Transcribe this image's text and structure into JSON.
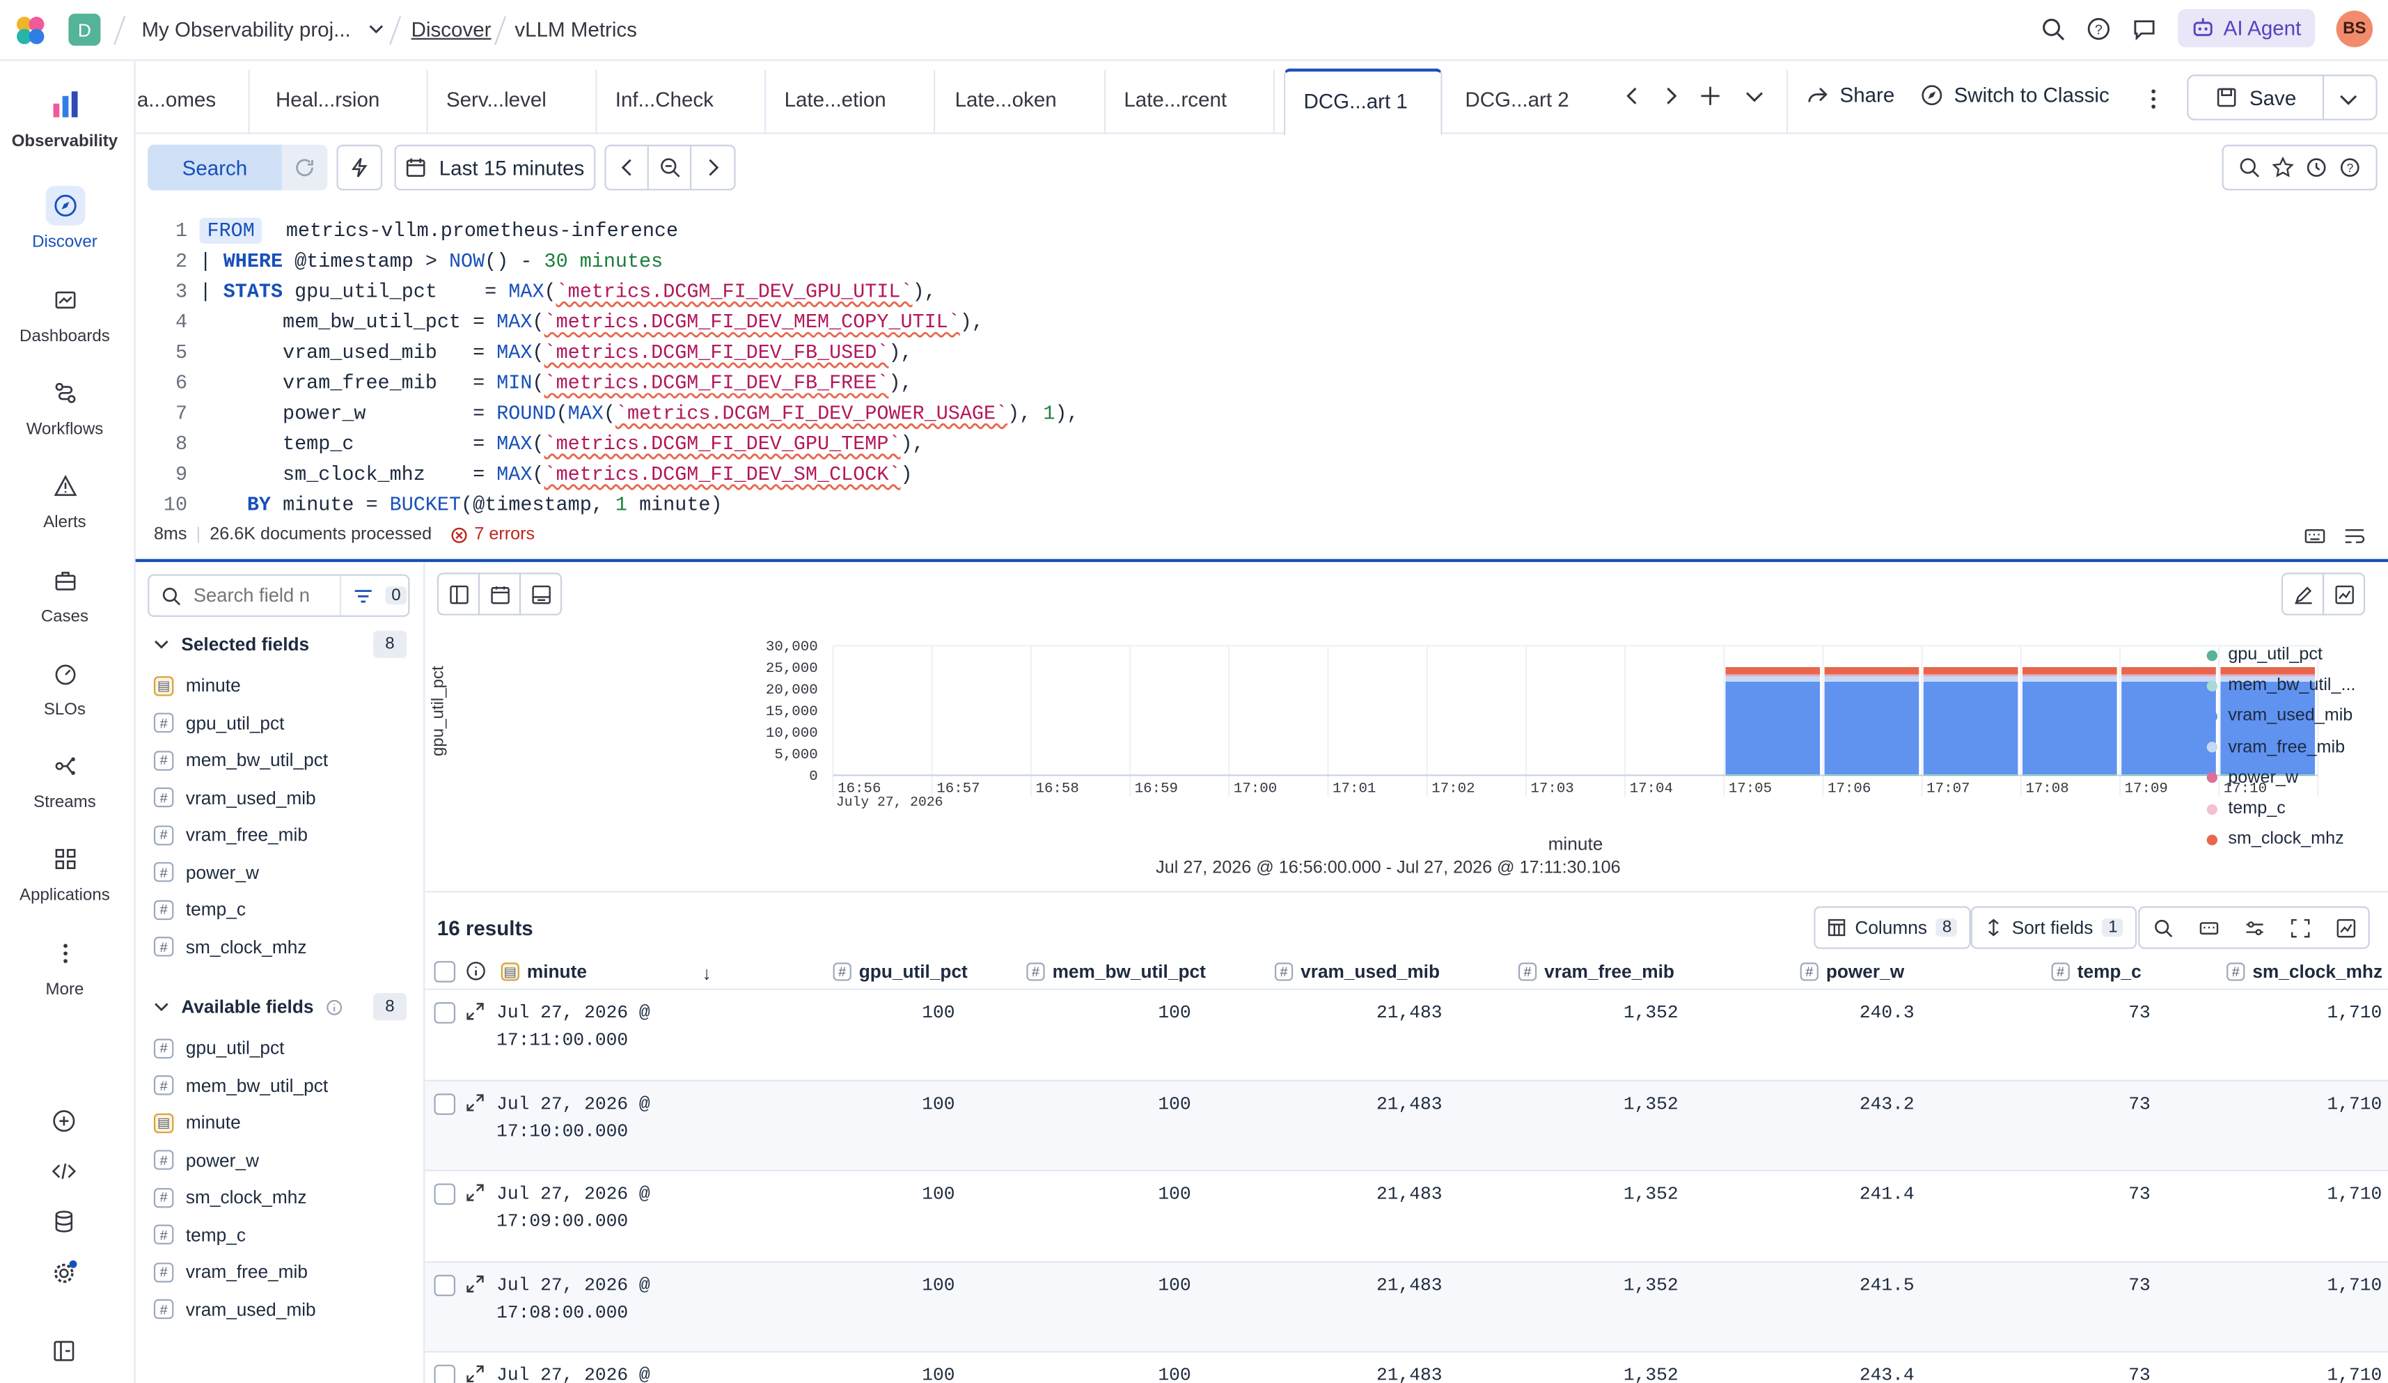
{
  "app": {
    "space_initial": "D",
    "project": "My Observability proj...",
    "breadcrumb_discover": "Discover",
    "breadcrumb_current": "vLLM Metrics",
    "ai_agent_label": "AI Agent",
    "avatar_initials": "BS",
    "brand_color": "#1750ba"
  },
  "nav": {
    "observability": "Observability",
    "discover": "Discover",
    "dashboards": "Dashboards",
    "workflows": "Workflows",
    "alerts": "Alerts",
    "cases": "Cases",
    "slos": "SLOs",
    "streams": "Streams",
    "applications": "Applications",
    "more": "More"
  },
  "tabs": [
    {
      "label": "a...omes"
    },
    {
      "label": "Heal...rsion"
    },
    {
      "label": "Serv...level"
    },
    {
      "label": "Inf...Check"
    },
    {
      "label": "Late...etion"
    },
    {
      "label": "Late...oken"
    },
    {
      "label": "Late...rcent"
    },
    {
      "label": "DCG...art 1"
    },
    {
      "label": "DCG...art 2"
    }
  ],
  "toolbar": {
    "share": "Share",
    "switch_classic": "Switch to Classic",
    "save": "Save",
    "search": "Search",
    "time_range": "Last 15 minutes"
  },
  "query": {
    "lines": [
      "1",
      "2",
      "3",
      "4",
      "5",
      "6",
      "7",
      "8",
      "9",
      "10"
    ],
    "status_ms": "8ms",
    "status_docs": "26.6K documents processed",
    "status_errors": "7 errors"
  },
  "fields": {
    "search_placeholder": "Search field n",
    "filter_count": "0",
    "selected_label": "Selected fields",
    "selected_count": "8",
    "selected": [
      "minute",
      "gpu_util_pct",
      "mem_bw_util_pct",
      "vram_used_mib",
      "vram_free_mib",
      "power_w",
      "temp_c",
      "sm_clock_mhz"
    ],
    "available_label": "Available fields",
    "available_count": "8",
    "available": [
      "gpu_util_pct",
      "mem_bw_util_pct",
      "minute",
      "power_w",
      "sm_clock_mhz",
      "temp_c",
      "vram_free_mib",
      "vram_used_mib"
    ]
  },
  "chart_data": {
    "type": "bar",
    "xlabel": "minute",
    "ylabel": "gpu_util_pct",
    "ylim": [
      0,
      30000
    ],
    "yticks": [
      "30,000",
      "25,000",
      "20,000",
      "15,000",
      "10,000",
      "5,000",
      "0"
    ],
    "categories": [
      "16:56",
      "16:57",
      "16:58",
      "16:59",
      "17:00",
      "17:01",
      "17:02",
      "17:03",
      "17:04",
      "17:05",
      "17:06",
      "17:07",
      "17:08",
      "17:09",
      "17:10"
    ],
    "first_tick_date": "July 27, 2026",
    "series": [
      {
        "name": "gpu_util_pct",
        "color": "#54b399",
        "values": [
          0,
          0,
          0,
          0,
          0,
          0,
          0,
          0,
          0,
          100,
          100,
          100,
          100,
          100,
          100
        ]
      },
      {
        "name": "mem_bw_util_...",
        "color": "#a8dbd3",
        "values": [
          0,
          0,
          0,
          0,
          0,
          0,
          0,
          0,
          0,
          100,
          100,
          100,
          100,
          100,
          100
        ]
      },
      {
        "name": "vram_used_mib",
        "color": "#6092f0",
        "values": [
          0,
          0,
          0,
          0,
          0,
          0,
          0,
          0,
          0,
          21483,
          21483,
          21483,
          21483,
          21483,
          21483
        ]
      },
      {
        "name": "vram_free_mib",
        "color": "#c7d8f5",
        "values": [
          0,
          0,
          0,
          0,
          0,
          0,
          0,
          0,
          0,
          1352,
          1352,
          1352,
          1352,
          1352,
          1352
        ]
      },
      {
        "name": "power_w",
        "color": "#e06f98",
        "values": [
          0,
          0,
          0,
          0,
          0,
          0,
          0,
          0,
          0,
          243,
          243,
          241,
          242,
          243,
          240
        ]
      },
      {
        "name": "temp_c",
        "color": "#f4c0d2",
        "values": [
          0,
          0,
          0,
          0,
          0,
          0,
          0,
          0,
          0,
          73,
          73,
          73,
          73,
          73,
          73
        ]
      },
      {
        "name": "sm_clock_mhz",
        "color": "#e7664c",
        "values": [
          0,
          0,
          0,
          0,
          0,
          0,
          0,
          0,
          0,
          1710,
          1710,
          1710,
          1710,
          1710,
          1710
        ]
      }
    ]
  },
  "chart_range": "Jul 27, 2026 @ 16:56:00.000 - Jul 27, 2026 @ 17:11:30.106",
  "results": {
    "count_label": "16 results",
    "columns_label": "Columns",
    "columns_count": "8",
    "sort_label": "Sort fields",
    "sort_count": "1",
    "headers": [
      "minute",
      "gpu_util_pct",
      "mem_bw_util_pct",
      "vram_used_mib",
      "vram_free_mib",
      "power_w",
      "temp_c",
      "sm_clock_mhz"
    ],
    "rows": [
      {
        "minute1": "Jul 27, 2026 @",
        "minute2": "17:11:00.000",
        "gpu": "100",
        "mem": "100",
        "used": "21,483",
        "free": "1,352",
        "power": "240.3",
        "temp": "73",
        "clock": "1,710"
      },
      {
        "minute1": "Jul 27, 2026 @",
        "minute2": "17:10:00.000",
        "gpu": "100",
        "mem": "100",
        "used": "21,483",
        "free": "1,352",
        "power": "243.2",
        "temp": "73",
        "clock": "1,710"
      },
      {
        "minute1": "Jul 27, 2026 @",
        "minute2": "17:09:00.000",
        "gpu": "100",
        "mem": "100",
        "used": "21,483",
        "free": "1,352",
        "power": "241.4",
        "temp": "73",
        "clock": "1,710"
      },
      {
        "minute1": "Jul 27, 2026 @",
        "minute2": "17:08:00.000",
        "gpu": "100",
        "mem": "100",
        "used": "21,483",
        "free": "1,352",
        "power": "241.5",
        "temp": "73",
        "clock": "1,710"
      },
      {
        "minute1": "Jul 27, 2026 @",
        "minute2": "",
        "gpu": "100",
        "mem": "100",
        "used": "21,483",
        "free": "1,352",
        "power": "243.4",
        "temp": "73",
        "clock": "1,710"
      }
    ]
  }
}
